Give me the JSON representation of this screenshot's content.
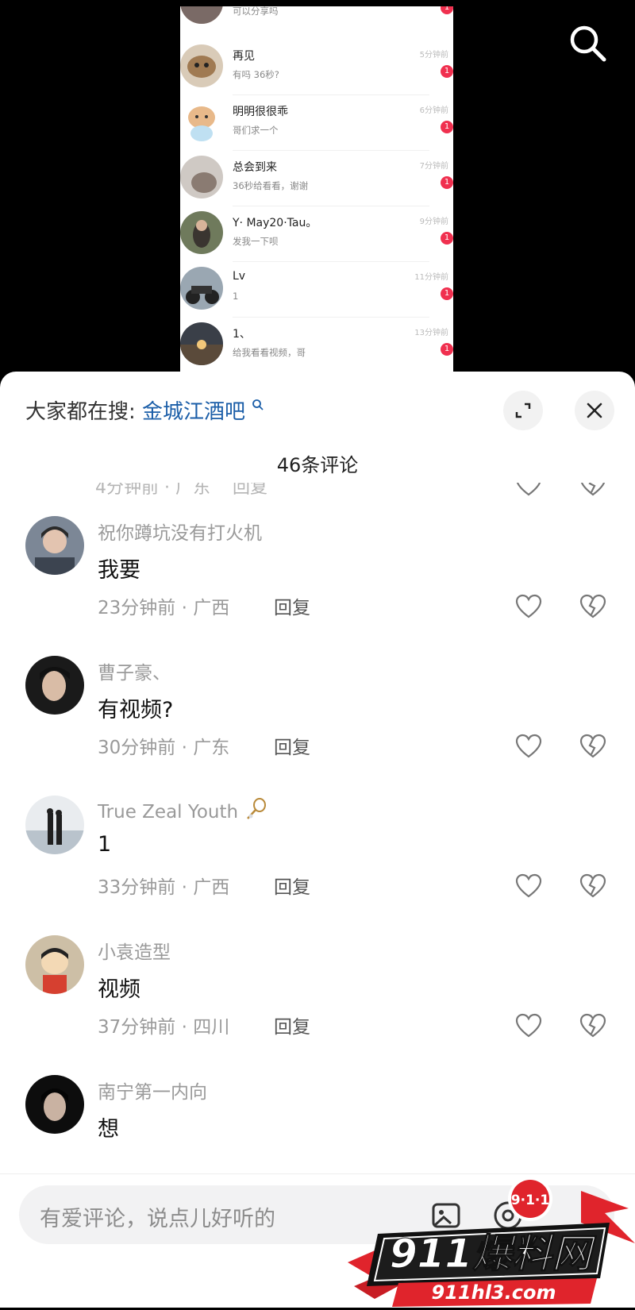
{
  "screenshot_chats": [
    {
      "name": "",
      "message": "可以分享吗",
      "time": "",
      "badge": "1"
    },
    {
      "name": "再见",
      "message": "有吗 36秒?",
      "time": "5分钟前",
      "badge": "1"
    },
    {
      "name": "明明很很乖",
      "message": "哥们求一个",
      "time": "6分钟前",
      "badge": "1"
    },
    {
      "name": "总会到来",
      "message": "36秒给看看，谢谢",
      "time": "7分钟前",
      "badge": "1"
    },
    {
      "name": "Y· May20·Tau。",
      "message": "发我一下呗",
      "time": "9分钟前",
      "badge": "1"
    },
    {
      "name": "Lv",
      "message": "1",
      "time": "11分钟前",
      "badge": "1"
    },
    {
      "name": "1、",
      "message": "给我看看视频，哥",
      "time": "13分钟前",
      "badge": "1"
    }
  ],
  "sheet": {
    "hot_prefix": "大家都在搜:",
    "hot_keyword": "金城江酒吧",
    "count_label": "46条评论",
    "partial_meta": "4分钟前 · 广东",
    "partial_reply": "回复"
  },
  "comments": [
    {
      "user": "祝你蹲坑没有打火机",
      "text": "我要",
      "meta": "23分钟前 · 广西",
      "reply": "回复"
    },
    {
      "user": "曹子豪、",
      "text": "有视频?",
      "meta": "30分钟前 · 广东",
      "reply": "回复"
    },
    {
      "user": "True Zeal Youth",
      "text": "1",
      "meta": "33分钟前 · 广西",
      "reply": "回复"
    },
    {
      "user": "小袁造型",
      "text": "视频",
      "meta": "37分钟前 · 四川",
      "reply": "回复"
    },
    {
      "user": "南宁第一内向",
      "text": "想",
      "meta": "",
      "reply": ""
    }
  ],
  "input": {
    "placeholder": "有爱评论，说点儿好听的"
  },
  "watermark": {
    "badge": "9·1·1",
    "brand": "911爆料网",
    "url": "911hl3.com"
  },
  "colors": {
    "link": "#1b5ea8",
    "badge": "#f0304f",
    "watermark_red": "#e0242c"
  },
  "icons": [
    "search-icon",
    "expand-icon",
    "close-icon",
    "heart-icon",
    "broken-heart-icon",
    "image-icon",
    "at-icon"
  ]
}
